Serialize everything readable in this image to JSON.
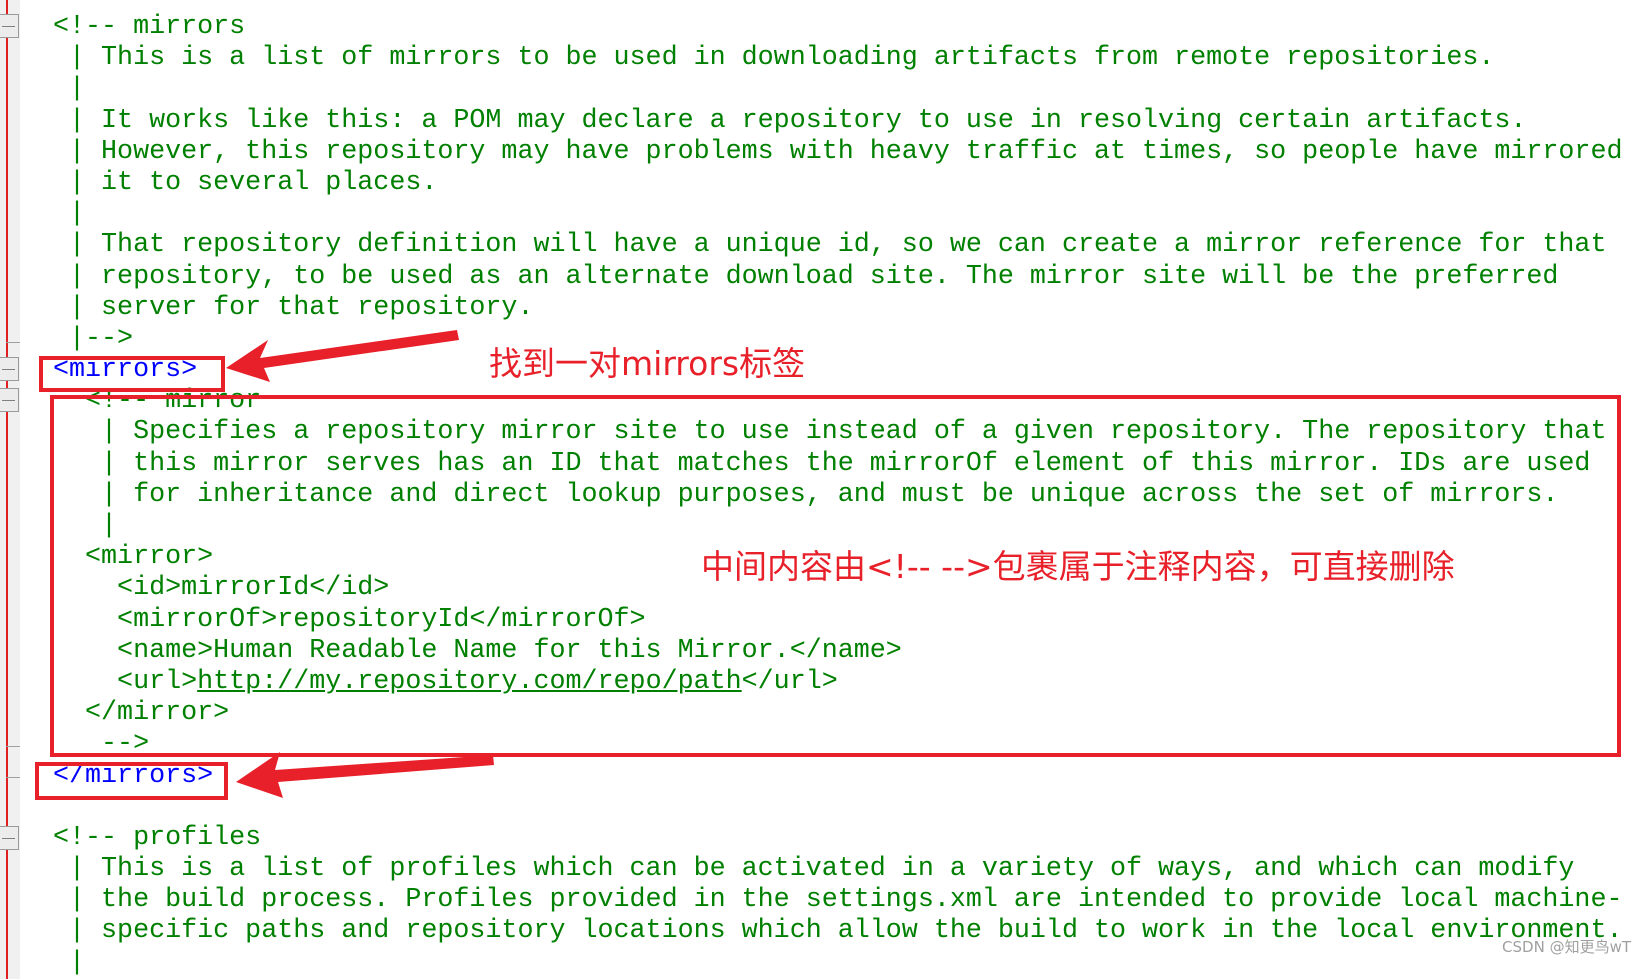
{
  "editor": {
    "lines": [
      {
        "text": "<!-- mirrors",
        "style": "comment"
      },
      {
        "text": " | This is a list of mirrors to be used in downloading artifacts from remote repositories.",
        "style": "comment"
      },
      {
        "text": " |",
        "style": "comment"
      },
      {
        "text": " | It works like this: a POM may declare a repository to use in resolving certain artifacts.",
        "style": "comment"
      },
      {
        "text": " | However, this repository may have problems with heavy traffic at times, so people have mirrored",
        "style": "comment"
      },
      {
        "text": " | it to several places.",
        "style": "comment"
      },
      {
        "text": " |",
        "style": "comment"
      },
      {
        "text": " | That repository definition will have a unique id, so we can create a mirror reference for that",
        "style": "comment"
      },
      {
        "text": " | repository, to be used as an alternate download site. The mirror site will be the preferred",
        "style": "comment"
      },
      {
        "text": " | server for that repository.",
        "style": "comment"
      },
      {
        "text": " |-->",
        "style": "comment"
      },
      {
        "text": "<mirrors>",
        "style": "tag"
      },
      {
        "text": "  <!-- mirror",
        "style": "comment"
      },
      {
        "text": "   | Specifies a repository mirror site to use instead of a given repository. The repository that",
        "style": "comment"
      },
      {
        "text": "   | this mirror serves has an ID that matches the mirrorOf element of this mirror. IDs are used",
        "style": "comment"
      },
      {
        "text": "   | for inheritance and direct lookup purposes, and must be unique across the set of mirrors.",
        "style": "comment"
      },
      {
        "text": "   |",
        "style": "comment"
      },
      {
        "text": "  <mirror>",
        "style": "comment"
      },
      {
        "text": "    <id>mirrorId</id>",
        "style": "comment"
      },
      {
        "text": "    <mirrorOf>repositoryId</mirrorOf>",
        "style": "comment"
      },
      {
        "text": "    <name>Human Readable Name for this Mirror.</name>",
        "style": "comment"
      },
      {
        "text": "    <url>",
        "style": "comment",
        "link": "http://my.repository.com/repo/path",
        "after": "</url>"
      },
      {
        "text": "  </mirror>",
        "style": "comment"
      },
      {
        "text": "   -->",
        "style": "comment"
      },
      {
        "text": "</mirrors>",
        "style": "tag"
      },
      {
        "text": "",
        "style": "comment"
      },
      {
        "text": "<!-- profiles",
        "style": "comment"
      },
      {
        "text": " | This is a list of profiles which can be activated in a variety of ways, and which can modify",
        "style": "comment"
      },
      {
        "text": " | the build process. Profiles provided in the settings.xml are intended to provide local machine-",
        "style": "comment"
      },
      {
        "text": " | specific paths and repository locations which allow the build to work in the local environment.",
        "style": "comment"
      },
      {
        "text": " |",
        "style": "comment"
      }
    ]
  },
  "annotations": {
    "note_mirrors": "找到一对mirrors标签",
    "note_comment": "中间内容由<!-- -->包裹属于注释内容，可直接删除"
  },
  "watermark": "CSDN @知更鸟wT",
  "colors": {
    "comment": "#008000",
    "tag": "#0000ff",
    "annotation": "#e8202a"
  }
}
